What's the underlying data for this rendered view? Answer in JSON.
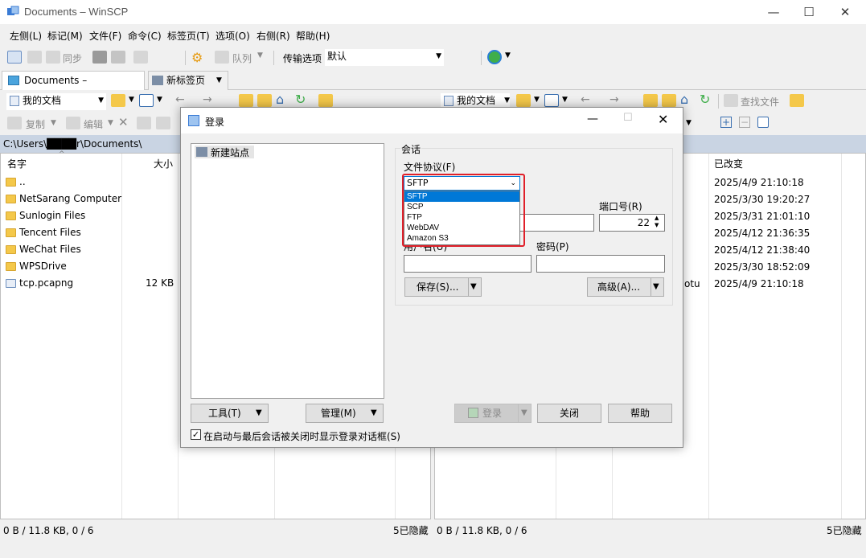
{
  "window": {
    "title": "Documents – WinSCP",
    "minimize": "—",
    "maximize": "☐",
    "close": "✕"
  },
  "menu": [
    "左侧(L)",
    "标记(M)",
    "文件(F)",
    "命令(C)",
    "标签页(T)",
    "选项(O)",
    "右侧(R)",
    "帮助(H)"
  ],
  "toolbar": {
    "sync_label": "同步",
    "queue_label": "队列",
    "transfer_label": "传输选项",
    "transfer_value": "默认"
  },
  "tabs": [
    {
      "label": "Documents – Documents"
    },
    {
      "label": "新标签页"
    }
  ],
  "left_nav": {
    "location": "我的文档",
    "copy_label": "复制",
    "edit_label": "编辑"
  },
  "right_nav": {
    "location": "我的文档",
    "find_label": "查找文件"
  },
  "left_panel": {
    "path": "C:\\Users\\████r\\Documents\\",
    "columns": [
      "名字",
      "大小"
    ],
    "rows": [
      {
        "name": "..",
        "size": ""
      },
      {
        "name": "NetSarang Computer",
        "size": ""
      },
      {
        "name": "Sunlogin Files",
        "size": ""
      },
      {
        "name": "Tencent Files",
        "size": ""
      },
      {
        "name": "WeChat Files",
        "size": ""
      },
      {
        "name": "WPSDrive",
        "size": ""
      },
      {
        "name": "tcp.pcapng",
        "size": "12 KB"
      }
    ],
    "status_left": "0 B / 11.8 KB,  0 / 6",
    "status_right": "5已隐藏"
  },
  "right_panel": {
    "columns": [
      "已改变"
    ],
    "partial": "otu",
    "dates": [
      "2025/4/9 21:10:18",
      "2025/3/30 19:20:27",
      "2025/3/31 21:01:10",
      "2025/4/12 21:36:35",
      "2025/4/12 21:38:40",
      "2025/3/30 18:52:09",
      "2025/4/9 21:10:18"
    ],
    "status_left": "0 B / 11.8 KB,  0 / 6",
    "status_right": "5已隐藏"
  },
  "dialog": {
    "title": "登录",
    "new_site": "新建站点",
    "session_group": "会话",
    "protocol_label": "文件协议(F)",
    "protocol_value": "SFTP",
    "protocol_options": [
      "SFTP",
      "SCP",
      "FTP",
      "WebDAV",
      "Amazon S3"
    ],
    "port_label": "端口号(R)",
    "port_value": "22",
    "user_label": "用户名(U)",
    "password_label": "密码(P)",
    "save_btn": "保存(S)...",
    "advanced_btn": "高级(A)...",
    "tools_btn": "工具(T)",
    "manage_btn": "管理(M)",
    "login_btn": "登录",
    "close_btn": "关闭",
    "help_btn": "帮助",
    "checkbox_label": "在启动与最后会话被关闭时显示登录对话框(S)"
  }
}
